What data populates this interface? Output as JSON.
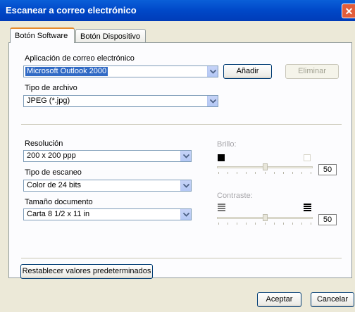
{
  "window": {
    "title": "Escanear a correo electrónico",
    "close_glyph": "✕"
  },
  "tabs": [
    {
      "label": "Botón Software",
      "active": true
    },
    {
      "label": "Botón Dispositivo",
      "active": false
    }
  ],
  "email_app": {
    "label": "Aplicación de correo electrónico",
    "value": "Microsoft Outlook 2000",
    "add_label": "Añadir",
    "remove_label": "Eliminar"
  },
  "file_type": {
    "label": "Tipo de archivo",
    "value": "JPEG (*.jpg)"
  },
  "resolution": {
    "label": "Resolución",
    "value": "200 x 200 ppp"
  },
  "scan_type": {
    "label": "Tipo de escaneo",
    "value": "Color de 24 bits"
  },
  "doc_size": {
    "label": "Tamaño documento",
    "value": "Carta 8 1/2 x 11 in"
  },
  "brightness": {
    "label": "Brillo:",
    "value": "50",
    "level": 0.5,
    "enabled": false
  },
  "contrast": {
    "label": "Contraste:",
    "value": "50",
    "level": 0.5,
    "enabled": false
  },
  "restore_label": "Restablecer valores predeterminados",
  "footer": {
    "ok_label": "Aceptar",
    "cancel_label": "Cancelar"
  },
  "colors": {
    "titlebar": "#0048c8",
    "selection": "#316ac5",
    "dialog_bg": "#ece9d8",
    "close_button": "#e25d3a"
  }
}
